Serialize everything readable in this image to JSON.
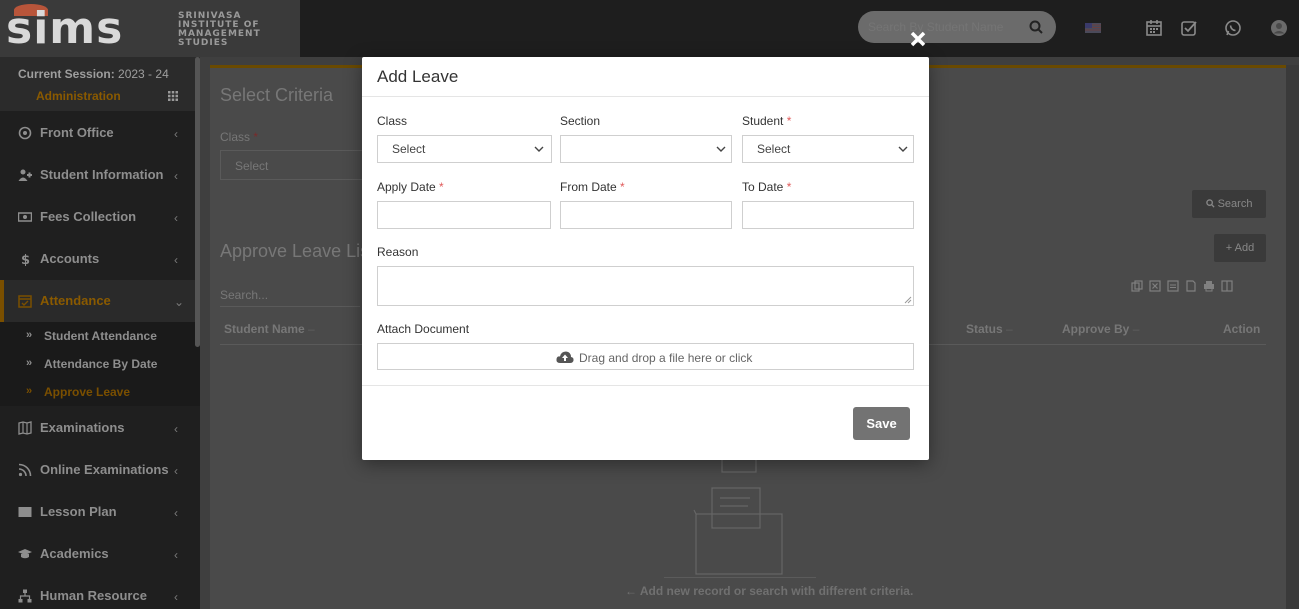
{
  "header": {
    "logo_text": "sims",
    "institute_lines": [
      "SRINIVASA",
      "INSTITUTE OF",
      "MANAGEMENT",
      "STUDIES"
    ],
    "search_placeholder": "Search By Student Name",
    "icons": [
      "search-icon",
      "flag-icon",
      "calendar-icon",
      "task-check-icon",
      "whatsapp-icon",
      "user-avatar-icon"
    ]
  },
  "sidebar": {
    "session_label": "Current Session:",
    "session_value": "2023 - 24",
    "role": "Administration",
    "items": [
      {
        "label": "Front Office",
        "icon": "front-office-icon"
      },
      {
        "label": "Student Information",
        "icon": "student-info-icon"
      },
      {
        "label": "Fees Collection",
        "icon": "money-icon"
      },
      {
        "label": "Accounts",
        "icon": "dollar-icon"
      },
      {
        "label": "Attendance",
        "icon": "calendar-check-icon"
      },
      {
        "label": "Examinations",
        "icon": "map-icon"
      },
      {
        "label": "Online Examinations",
        "icon": "rss-icon"
      },
      {
        "label": "Lesson Plan",
        "icon": "board-icon"
      },
      {
        "label": "Academics",
        "icon": "graduation-cap-icon"
      },
      {
        "label": "Human Resource",
        "icon": "sitemap-icon"
      }
    ],
    "subitems": [
      "Student Attendance",
      "Attendance By Date",
      "Approve Leave"
    ],
    "arrow": "»",
    "chevron": "‹",
    "chevron_open": "⌄"
  },
  "main": {
    "select_criteria_title": "Select Criteria",
    "class_label": "Class",
    "class_value": "Select",
    "search_button": "Search",
    "list_title": "Approve Leave List",
    "add_button": "+ Add",
    "table_search_placeholder": "Search...",
    "columns": [
      "Student Name",
      "Status",
      "Approve By",
      "Action"
    ],
    "empty_message": "← Add new record or search with different criteria."
  },
  "modal": {
    "title": "Add Leave",
    "class_label": "Class",
    "class_value": "Select",
    "section_label": "Section",
    "section_value": "",
    "student_label": "Student",
    "student_value": "Select",
    "apply_date_label": "Apply Date",
    "from_date_label": "From Date",
    "to_date_label": "To Date",
    "reason_label": "Reason",
    "attach_label": "Attach Document",
    "dropzone_text": "Drag and drop a file here or click",
    "save_label": "Save",
    "required_mark": "*"
  },
  "colors": {
    "accent_orange": "#7a4f00",
    "required_red": "#e05a5a",
    "save_gray": "#737373"
  }
}
